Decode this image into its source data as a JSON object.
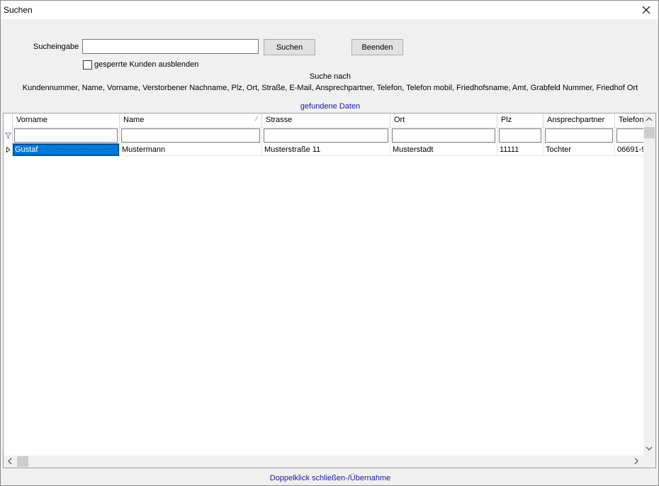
{
  "window": {
    "title": "Suchen"
  },
  "search": {
    "label": "Sucheingabe",
    "value": "",
    "search_button": "Suchen",
    "exit_button": "Beenden",
    "hide_blocked_label": "gesperrte Kunden ausblenden",
    "hide_blocked_checked": false,
    "search_by_heading": "Suche nach",
    "search_by_fields": "Kundennummer, Name, Vorname, Verstorbener Nachname, Plz, Ort, Straße, E-Mail, Ansprechpartner, Telefon, Telefon mobil, Friedhofsname, Amt, Grabfeld Nummer, Friedhof Ort"
  },
  "results": {
    "caption": "gefundene Daten",
    "columns": [
      "Vorname",
      "Name",
      "Strasse",
      "Ort",
      "Plz",
      "Ansprechpartner",
      "Telefon"
    ],
    "sorted_column": "Name",
    "rows": [
      [
        "Gustaf",
        "Mustermann",
        "Musterstraße 11",
        "Musterstadt",
        "11111",
        "Tochter",
        "06691-9"
      ]
    ],
    "selected_cell": "Gustaf"
  },
  "footer": {
    "hint": "Doppelklick schließen-/Übernahme"
  },
  "colors": {
    "accent": "#1a1aa6",
    "selection": "#0078d7"
  },
  "icons": [
    "close-icon",
    "filter-icon",
    "row-indicator-icon",
    "sort-icon",
    "arrow-up-icon",
    "arrow-down-icon",
    "arrow-left-icon",
    "arrow-right-icon"
  ]
}
